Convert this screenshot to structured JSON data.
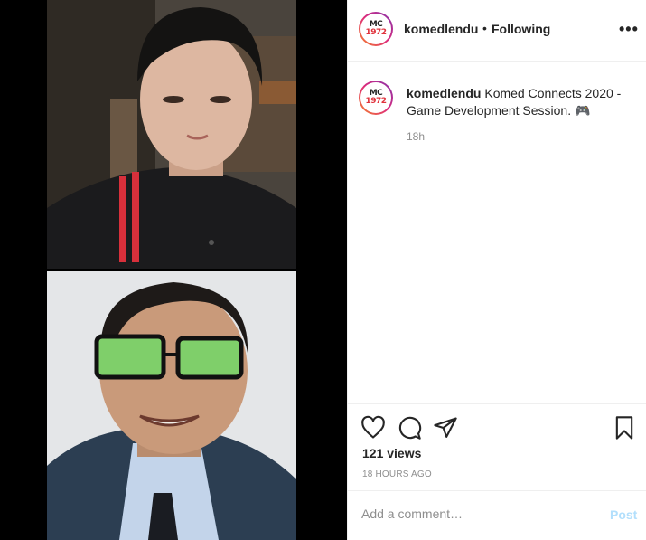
{
  "post": {
    "username": "komedlendu",
    "dot": "•",
    "follow_label": "Following",
    "more_label": "•••",
    "logo_line1": "MC",
    "logo_line2": "1972",
    "caption_text": "Komed Connects 2020 - Game Development Session. 🎮",
    "caption_time": "18h",
    "views": "121 views",
    "posted_ago": "18 HOURS AGO",
    "comment_placeholder": "Add a comment…",
    "post_label": "Post"
  },
  "icons": {
    "like": "heart-icon",
    "comment": "comment-icon",
    "share": "share-icon",
    "save": "bookmark-icon",
    "more": "more-icon"
  },
  "colors": {
    "text": "#262626",
    "muted": "#8e8e8e",
    "post_disabled": "#b2dffc",
    "divider": "#efefef"
  }
}
